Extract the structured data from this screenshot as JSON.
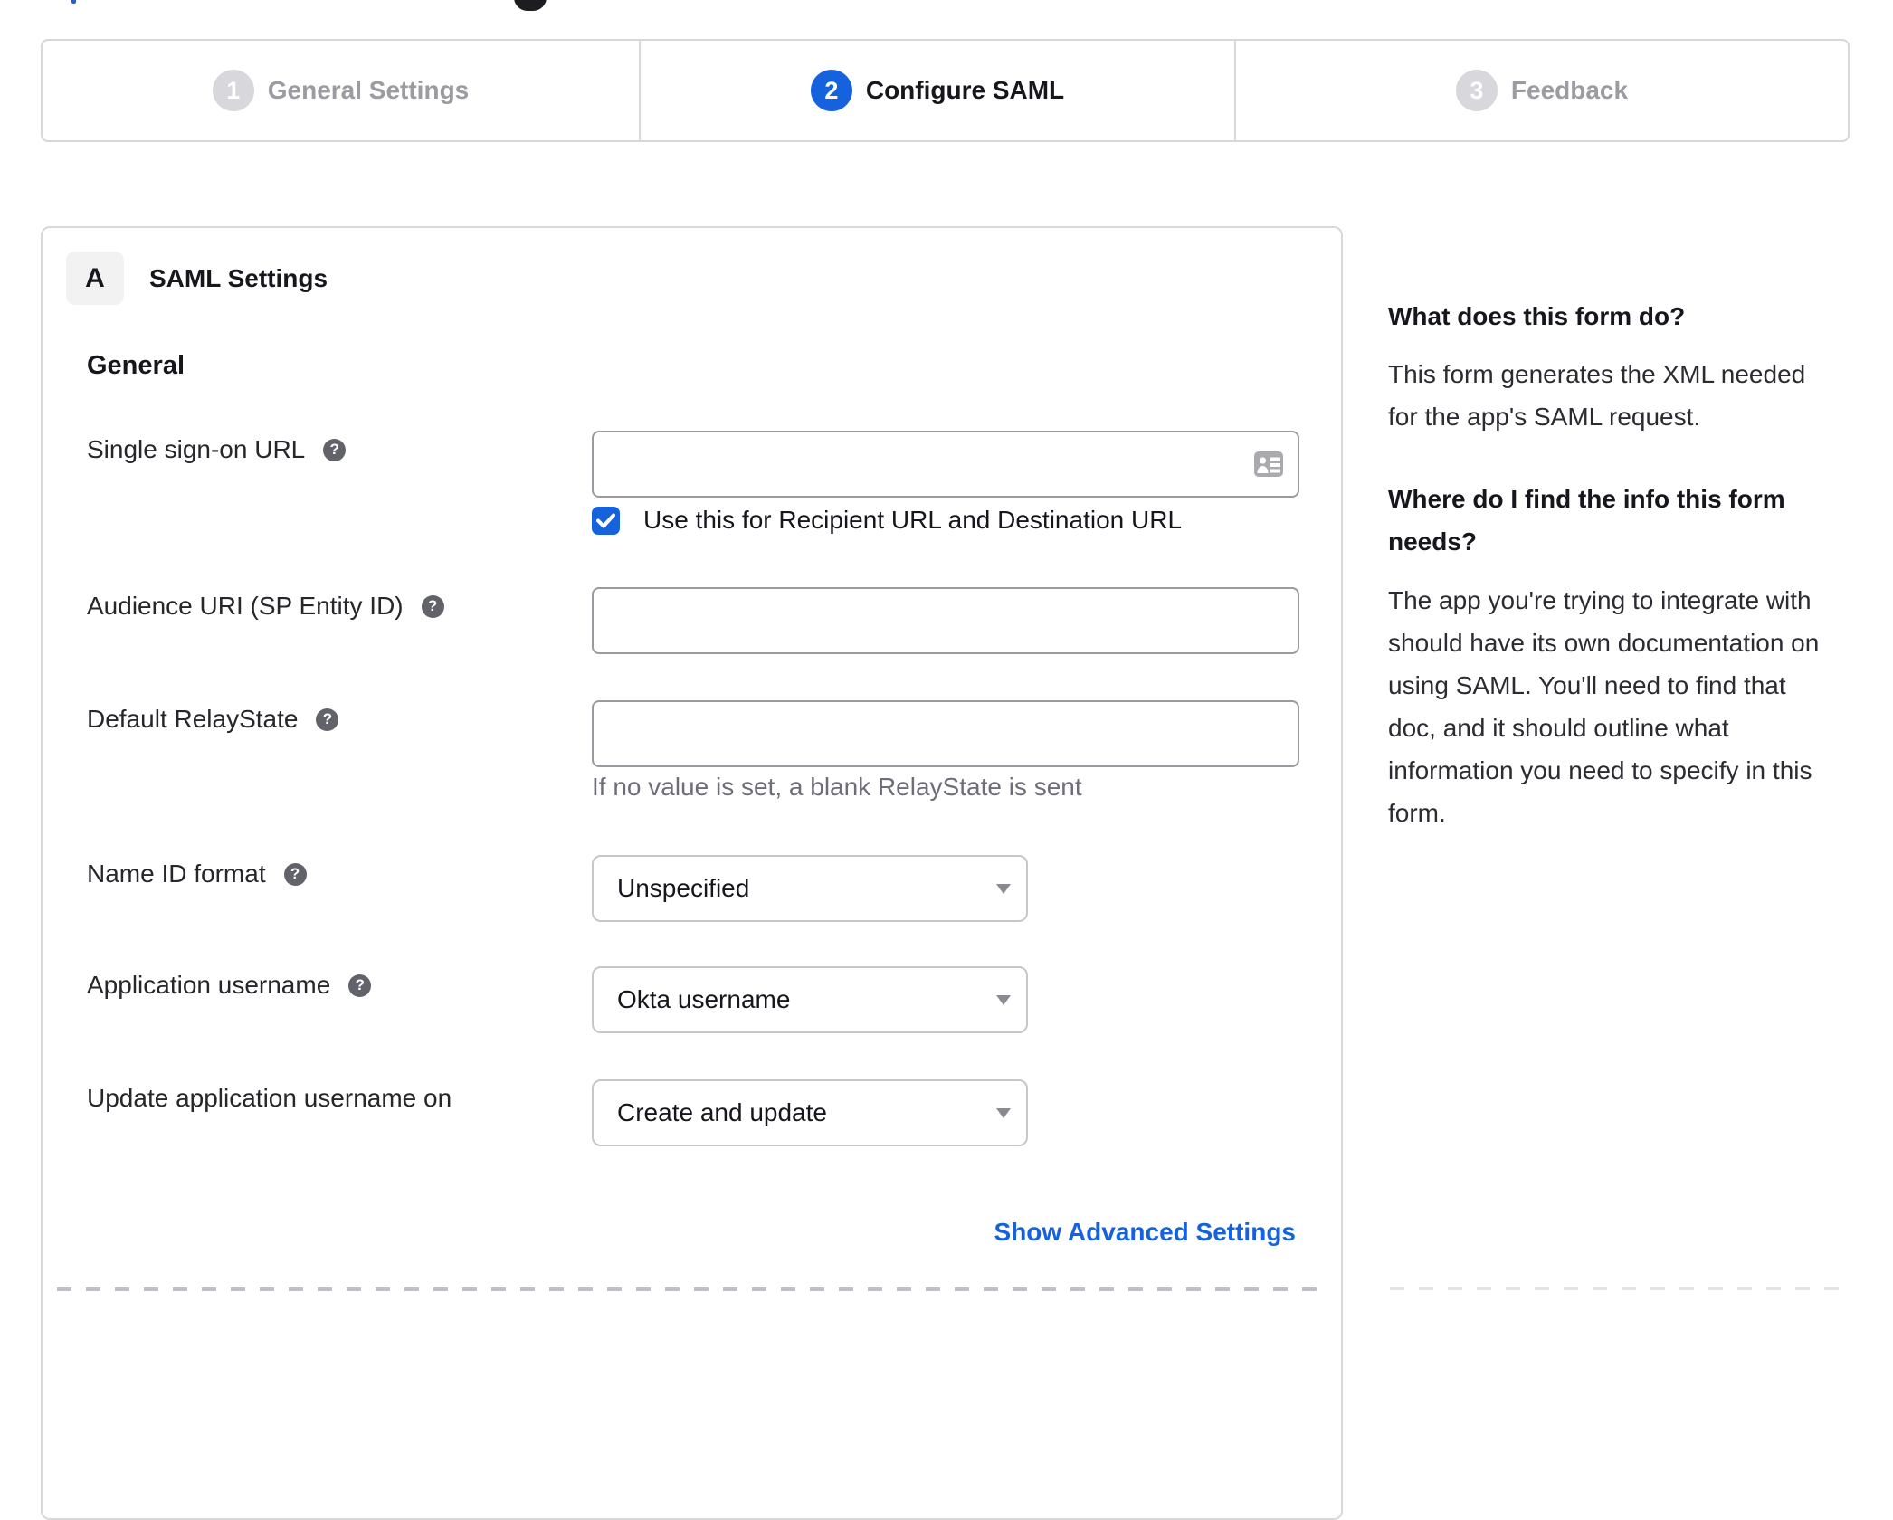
{
  "stepper": {
    "steps": [
      {
        "number": "1",
        "label": "General Settings",
        "state": "inactive"
      },
      {
        "number": "2",
        "label": "Configure SAML",
        "state": "active"
      },
      {
        "number": "3",
        "label": "Feedback",
        "state": "inactive"
      }
    ]
  },
  "panel": {
    "section_letter": "A",
    "section_title": "SAML Settings",
    "group_heading": "General",
    "fields": {
      "sso_url": {
        "label": "Single sign-on URL",
        "value": "",
        "checkbox_label": "Use this for Recipient URL and Destination URL",
        "checkbox_checked": true
      },
      "audience_uri": {
        "label": "Audience URI (SP Entity ID)",
        "value": ""
      },
      "relay_state": {
        "label": "Default RelayState",
        "value": "",
        "helper": "If no value is set, a blank RelayState is sent"
      },
      "name_id_format": {
        "label": "Name ID format",
        "value": "Unspecified"
      },
      "app_username": {
        "label": "Application username",
        "value": "Okta username"
      },
      "update_app_username": {
        "label": "Update application username on",
        "value": "Create and update"
      }
    },
    "advanced_link": "Show Advanced Settings"
  },
  "sidebar": {
    "sections": [
      {
        "heading": "What does this form do?",
        "body": [
          "This form generates the XML needed",
          "for the app's SAML request."
        ]
      },
      {
        "heading": [
          "Where do I find the info this form",
          "needs?"
        ],
        "body": [
          "The app you're trying to integrate with",
          "should have its own documentation on",
          "using SAML. You'll need to find that",
          "doc, and it should outline what",
          "information you need to specify in this",
          "form."
        ]
      }
    ]
  },
  "colors": {
    "accent_blue": "#1662dd",
    "inactive_gray": "#d7d7dc",
    "text_dark": "#16161d"
  }
}
